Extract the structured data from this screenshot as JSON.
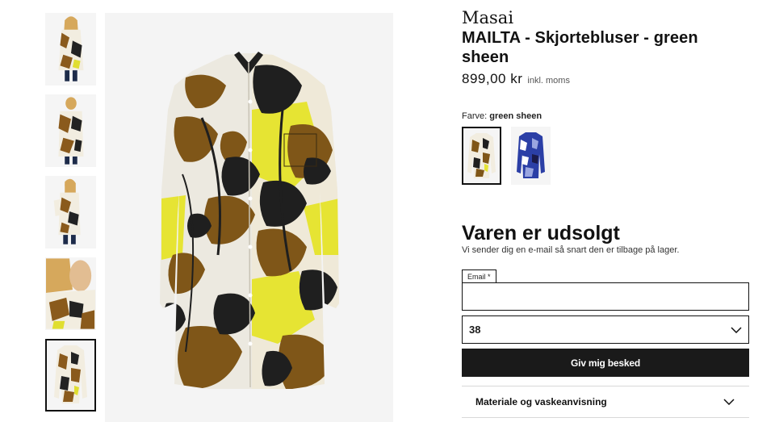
{
  "product": {
    "brand": "Masai",
    "title": "MAILTA - Skjortebluser - green sheen",
    "price": "899,00 kr",
    "vat_note": "inkl. moms"
  },
  "color": {
    "label": "Farve:",
    "selected": "green sheen",
    "swatches": [
      {
        "name": "green sheen",
        "primary": "#7a5418",
        "accent": "#e8e632",
        "active": true
      },
      {
        "name": "blue",
        "primary": "#2b3fa6",
        "accent": "#ffffff",
        "active": false
      }
    ]
  },
  "availability": {
    "heading": "Varen er udsolgt",
    "subtext": "Vi sender dig en e-mail så snart den er tilbage på lager."
  },
  "form": {
    "email_label": "Email *",
    "email_value": "",
    "size_value": "38",
    "notify_button": "Giv mig besked"
  },
  "accordion": {
    "material_label": "Materiale og vaskeanvisning"
  },
  "gallery": {
    "thumbnails": [
      "model-front",
      "model-back",
      "model-side",
      "model-detail",
      "product-flat"
    ],
    "active_index": 4
  }
}
